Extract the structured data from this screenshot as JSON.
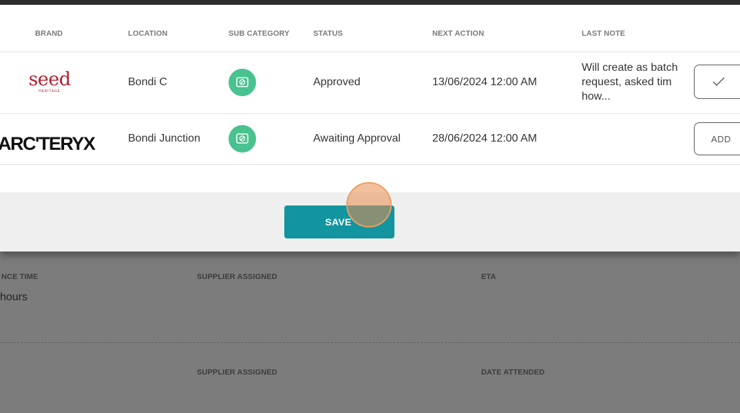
{
  "background": {
    "fields_row1": [
      {
        "label": "NCE TIME",
        "value": "hours"
      },
      {
        "label": "SUPPLIER ASSIGNED",
        "value": ""
      },
      {
        "label": "ETA",
        "value": ""
      }
    ],
    "fields_row2": [
      {
        "label": "SUPPLIER ASSIGNED"
      },
      {
        "label": "DATE ATTENDED"
      }
    ]
  },
  "table": {
    "headers": {
      "brand": "BRAND",
      "location": "LOCATION",
      "sub_category": "SUB CATEGORY",
      "status": "STATUS",
      "next_action": "NEXT ACTION",
      "last_note": "LAST NOTE"
    },
    "rows": [
      {
        "brand_logo_text": "seed",
        "brand_logo_subtext": "HERITAGE",
        "location": "Bondi C",
        "sub_category_icon": "no-entry-icon",
        "status": "Approved",
        "next_action": "13/06/2024 12:00 AM",
        "last_note": "Will create as batch request, asked tim how...",
        "action_icon": "checkmark-icon"
      },
      {
        "brand_logo_text": "ARC'TERYX",
        "location": "Bondi Junction",
        "sub_category_icon": "no-entry-icon",
        "status": "Awaiting Approval",
        "next_action": "28/06/2024 12:00 AM",
        "last_note": "",
        "action_label": "ADD"
      }
    ]
  },
  "footer": {
    "save_label": "SAVE"
  },
  "colors": {
    "accent": "#13959f",
    "subcategory": "#49c290",
    "seed_brand": "#b41e2e"
  }
}
